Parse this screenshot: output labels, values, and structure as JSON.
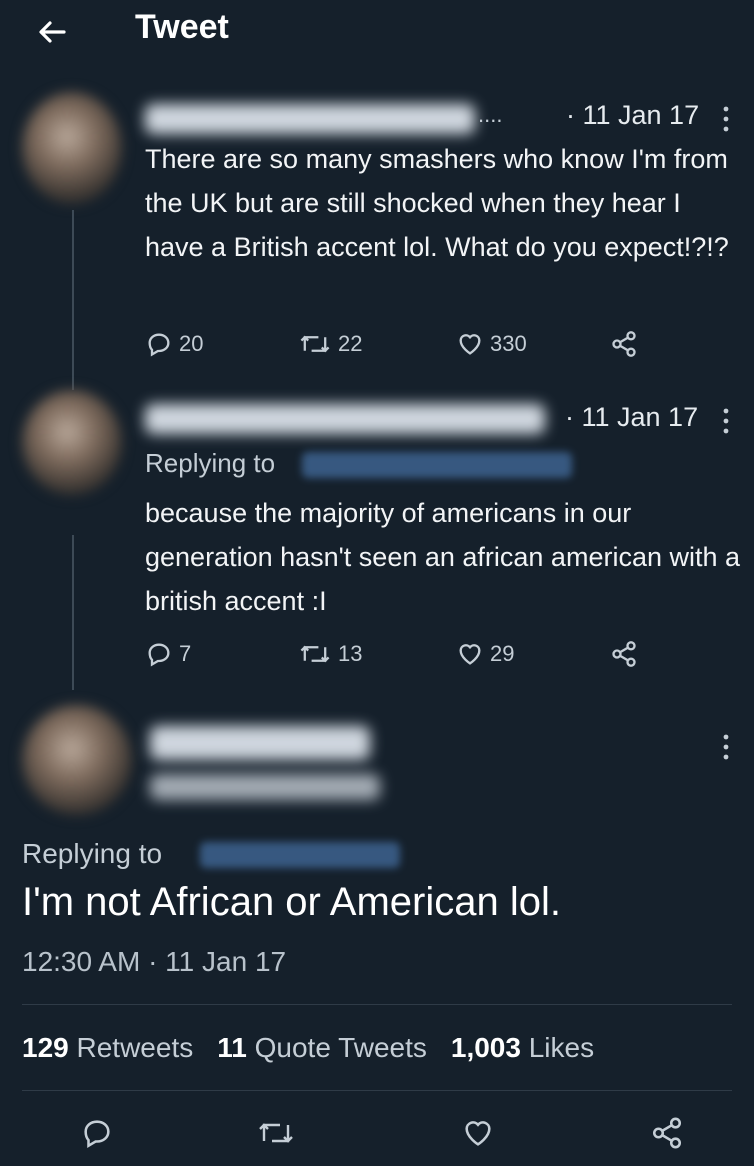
{
  "header": {
    "title": "Tweet"
  },
  "tweets": [
    {
      "handle_fragment": "....",
      "meta": "· 11 Jan 17",
      "text": "There are so many smashers who know I'm from the UK but are still shocked when they hear I have a British accent lol. What do you expect!?!?",
      "replies": "20",
      "retweets": "22",
      "likes": "330"
    },
    {
      "meta": "· 11 Jan 17",
      "replying_label": "Replying to",
      "text": "because the majority of americans in our generation hasn't seen an african american with a british accent :I",
      "replies": "7",
      "retweets": "13",
      "likes": "29"
    }
  ],
  "main": {
    "replying_label": "Replying to",
    "text": "I'm not African or American lol.",
    "timestamp": "12:30 AM · 11 Jan 17",
    "stats": {
      "retweets_count": "129",
      "retweets_label": "Retweets",
      "quotes_count": "11",
      "quotes_label": "Quote Tweets",
      "likes_count": "1,003",
      "likes_label": "Likes"
    }
  },
  "icons": {
    "back": "arrow-left-icon",
    "more": "more-vertical-icon",
    "reply": "reply-icon",
    "retweet": "retweet-icon",
    "like": "heart-icon",
    "share": "share-icon"
  },
  "colors": {
    "background": "#15202b",
    "text": "#ffffff",
    "muted": "#8b98a5",
    "divider": "#2f3b47"
  }
}
